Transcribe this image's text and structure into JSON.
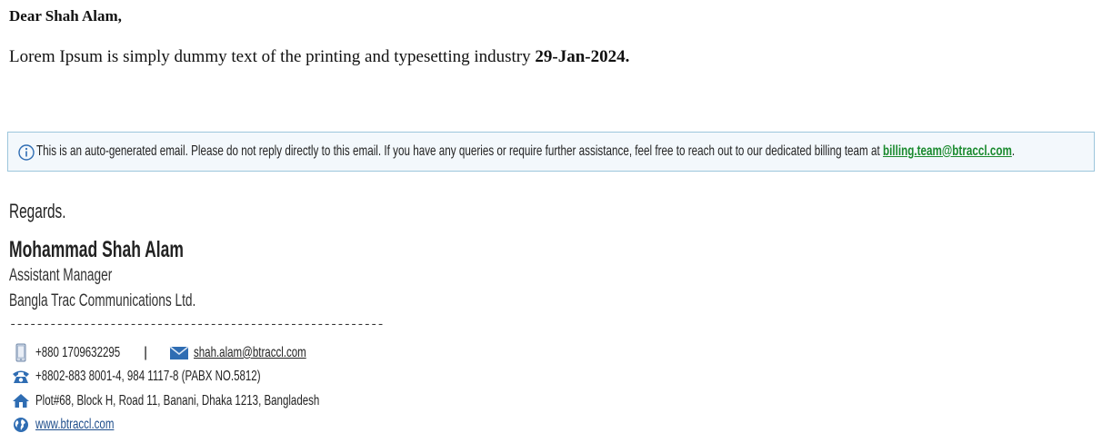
{
  "email": {
    "greeting": "Dear Shah Alam,",
    "intro_text": "Lorem Ipsum is simply dummy text of the printing and typesetting industry",
    "intro_date": "29-Jan-2024."
  },
  "notice": {
    "icon": "info-icon",
    "text": "This is an auto-generated email. Please do not reply directly to this email. If you have any queries or require further assistance, feel free to reach out to our dedicated billing team at ",
    "link": "billing.team@btraccl.com",
    "suffix": "."
  },
  "signature": {
    "regards": "Regards.",
    "name": "Mohammad Shah Alam",
    "title": "Assistant Manager",
    "company": "Bangla Trac Communications Ltd.",
    "divider": "--------------------------------------------------------",
    "mobile": "+880 1709632295",
    "separator": "|",
    "email": "shah.alam@btraccl.com",
    "phone": "+8802-883 8001-4, 984 1117-8 (PABX NO.5812)",
    "address": "Plot#68, Block H, Road 11, Banani, Dhaka 1213, Bangladesh",
    "website": "www.btraccl.com"
  },
  "colors": {
    "notice_bg": "#f3f8fc",
    "notice_border": "#9cc6dc",
    "link_green": "#1a8a2e",
    "link_blue": "#1f4e8c",
    "icon_blue": "#2f6db3"
  }
}
